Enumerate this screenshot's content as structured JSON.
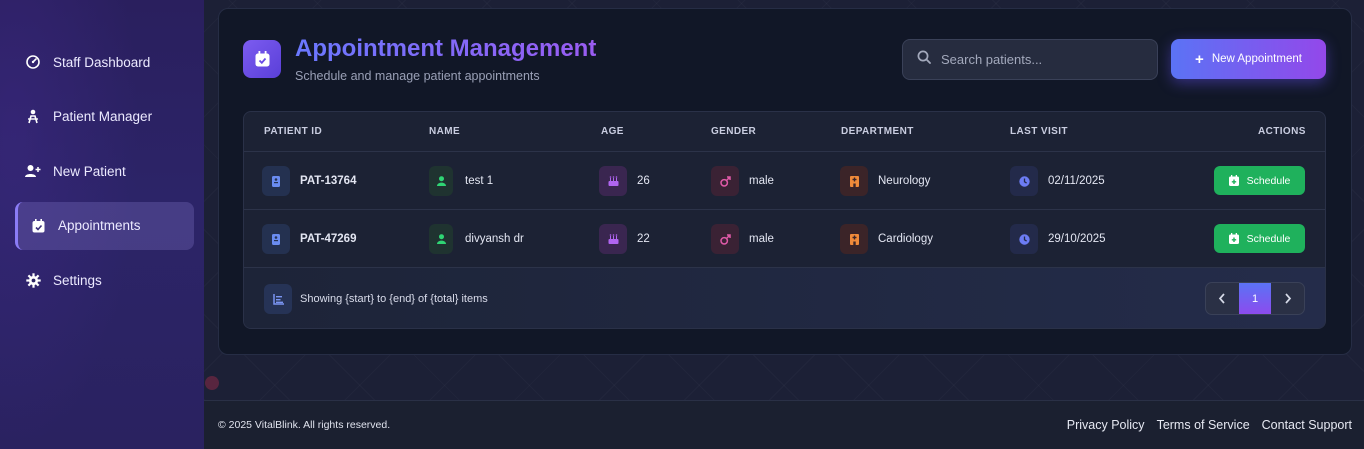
{
  "sidebar": {
    "items": [
      {
        "label": "Staff Dashboard",
        "icon": "dashboard-icon"
      },
      {
        "label": "Patient Manager",
        "icon": "patient-manager-icon"
      },
      {
        "label": "New Patient",
        "icon": "add-user-icon"
      },
      {
        "label": "Appointments",
        "icon": "calendar-icon",
        "active": true
      },
      {
        "label": "Settings",
        "icon": "gear-icon"
      }
    ]
  },
  "header": {
    "title": "Appointment Management",
    "subtitle": "Schedule and manage patient appointments"
  },
  "search": {
    "placeholder": "Search patients..."
  },
  "new_button": {
    "label": "New Appointment"
  },
  "table": {
    "columns": [
      "PATIENT ID",
      "NAME",
      "AGE",
      "GENDER",
      "DEPARTMENT",
      "LAST VISIT",
      "ACTIONS"
    ],
    "rows": [
      {
        "id": "PAT-13764",
        "name": "test 1",
        "age": "26",
        "gender": "male",
        "department": "Neurology",
        "last_visit": "02/11/2025",
        "action": "Schedule"
      },
      {
        "id": "PAT-47269",
        "name": "divyansh dr",
        "age": "22",
        "gender": "male",
        "department": "Cardiology",
        "last_visit": "29/10/2025",
        "action": "Schedule"
      }
    ],
    "showing": "Showing {start} to {end} of {total} items",
    "page": "1"
  },
  "footer": {
    "copyright": "© 2025 VitalBlink. All rights reserved.",
    "links": [
      "Privacy Policy",
      "Terms of Service",
      "Contact Support"
    ]
  },
  "colors": {
    "accent_start": "#5b73f5",
    "accent_end": "#9348ea",
    "schedule_green": "#1fb15c",
    "card_bg": "#111727"
  }
}
